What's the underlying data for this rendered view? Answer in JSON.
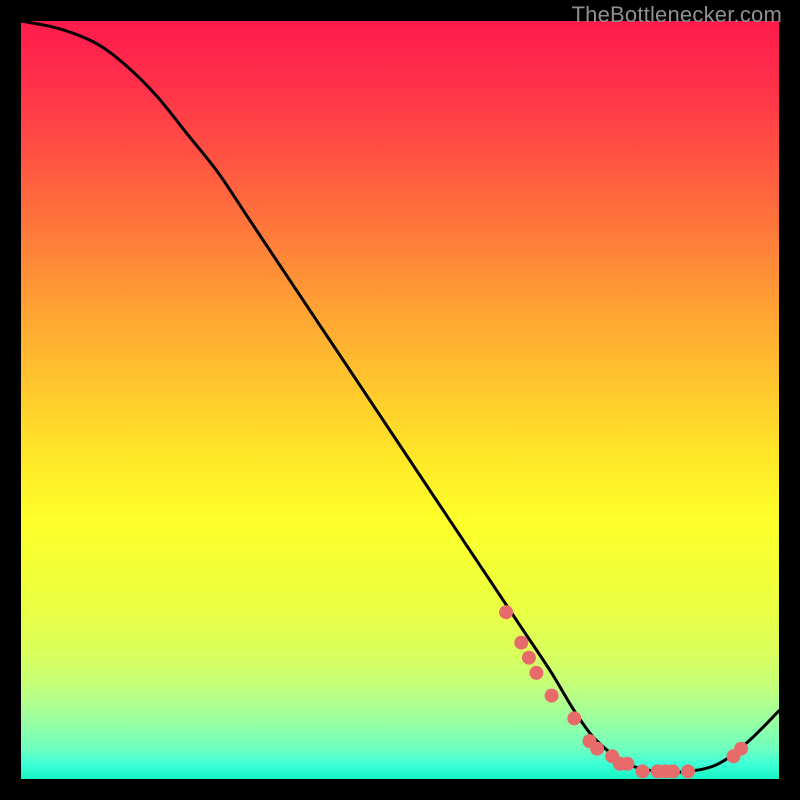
{
  "attribution": "TheBottlenecker.com",
  "colors": {
    "marker": "#e86b6b",
    "curve": "#000000",
    "gradient_top": "#ff1b4d",
    "gradient_bottom": "#15f5c5"
  },
  "chart_data": {
    "type": "line",
    "title": "",
    "xlabel": "",
    "ylabel": "",
    "xlim": [
      0,
      100
    ],
    "ylim": [
      0,
      100
    ],
    "series": [
      {
        "name": "bottleneck-curve",
        "x": [
          0,
          5,
          10,
          14,
          18,
          22,
          26,
          30,
          34,
          38,
          42,
          46,
          50,
          54,
          58,
          62,
          66,
          70,
          73,
          76,
          80,
          84,
          88,
          92,
          96,
          100
        ],
        "y": [
          100,
          99,
          97,
          94,
          90,
          85,
          80,
          74,
          68,
          62,
          56,
          50,
          44,
          38,
          32,
          26,
          20,
          14,
          9,
          5,
          2,
          1,
          1,
          2,
          5,
          9
        ]
      }
    ],
    "markers": {
      "name": "highlighted-points",
      "x": [
        64,
        66,
        67,
        68,
        70,
        73,
        75,
        76,
        78,
        79,
        80,
        82,
        84,
        85,
        86,
        88,
        94,
        95
      ],
      "y": [
        22,
        18,
        16,
        14,
        11,
        8,
        5,
        4,
        3,
        2,
        2,
        1,
        1,
        1,
        1,
        1,
        3,
        4
      ]
    }
  }
}
